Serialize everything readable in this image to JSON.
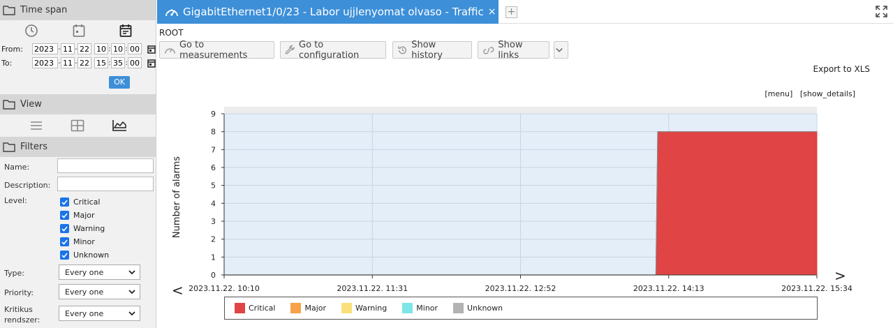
{
  "sidebar": {
    "time_span": {
      "title": "Time span",
      "from_label": "From:",
      "to_label": "To:",
      "from": {
        "year": "2023",
        "month": "11",
        "day": "22",
        "hour": "10",
        "minute": "10",
        "second": "00"
      },
      "to": {
        "year": "2023",
        "month": "11",
        "day": "22",
        "hour": "15",
        "minute": "35",
        "second": "00"
      },
      "ok_label": "OK"
    },
    "view": {
      "title": "View"
    },
    "filters": {
      "title": "Filters",
      "name_label": "Name:",
      "description_label": "Description:",
      "level_label": "Level:",
      "levels": [
        "Critical",
        "Major",
        "Warning",
        "Minor",
        "Unknown"
      ],
      "type_label": "Type:",
      "type_value": "Every one",
      "priority_label": "Priority:",
      "priority_value": "Every one",
      "kritikus_label_1": "Kritikus",
      "kritikus_label_2": "rendszer:",
      "kritikus_value": "Every one"
    }
  },
  "tab": {
    "title": "GigabitEthernet1/0/23 - Labor ujjlenyomat olvaso - Traffic",
    "close": "×",
    "add": "+"
  },
  "breadcrumb": "ROOT",
  "toolbar": {
    "measurements": "Go to measurements",
    "configuration": "Go to configuration",
    "history": "Show history",
    "links": "Show links"
  },
  "export_label": "Export to XLS",
  "menu_link": "[menu]",
  "details_link": "[show_details]",
  "nav": {
    "prev": "<",
    "next": ">"
  },
  "colors": {
    "critical": "#e04444",
    "major": "#f7a24a",
    "warning": "#f9e07a",
    "minor": "#7de6e6",
    "unknown": "#b3b3b3",
    "accent": "#3d8fd8"
  },
  "chart_data": {
    "type": "area",
    "ylabel": "Number of alarms",
    "ylim": [
      0,
      9
    ],
    "yticks": [
      0,
      1,
      2,
      3,
      4,
      5,
      6,
      7,
      8,
      9
    ],
    "x_ticks": [
      "2023.11.22. 10:10",
      "2023.11.22. 11:31",
      "2023.11.22. 12:52",
      "2023.11.22. 14:13",
      "2023.11.22. 15:34"
    ],
    "x_range": [
      "2023.11.22. 10:10",
      "2023.11.22. 15:34"
    ],
    "series": [
      {
        "name": "Critical",
        "color": "#e04444",
        "points": [
          [
            "2023.11.22. 10:10",
            0
          ],
          [
            "2023.11.22. 14:06",
            0
          ],
          [
            "2023.11.22. 14:07",
            8
          ],
          [
            "2023.11.22. 15:34",
            8
          ]
        ]
      },
      {
        "name": "Major",
        "color": "#f7a24a",
        "points": []
      },
      {
        "name": "Warning",
        "color": "#f9e07a",
        "points": []
      },
      {
        "name": "Minor",
        "color": "#7de6e6",
        "points": []
      },
      {
        "name": "Unknown",
        "color": "#b3b3b3",
        "points": []
      }
    ],
    "grid": true,
    "legend_position": "bottom"
  }
}
